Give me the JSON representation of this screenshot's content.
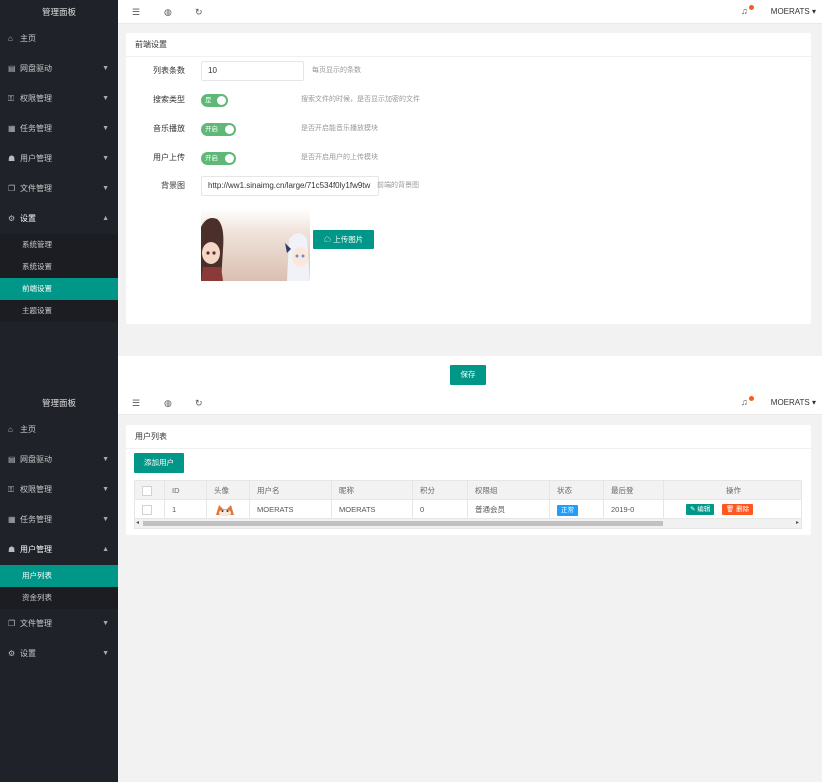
{
  "app_title": "管理面板",
  "user_name": "MOERATS",
  "icons": {
    "menu": "menu-icon",
    "globe": "globe-icon",
    "refresh": "refresh-icon",
    "bell": "bell-icon"
  },
  "accent_color": "#009688",
  "screen1": {
    "nav": [
      {
        "label": "主页",
        "icon": "home-icon",
        "glyph": "⌂",
        "arrow": ""
      },
      {
        "label": "网盘驱动",
        "icon": "drive-icon",
        "glyph": "▤",
        "arrow": "▼"
      },
      {
        "label": "权限管理",
        "icon": "key-icon",
        "glyph": "⚿",
        "arrow": "▼"
      },
      {
        "label": "任务管理",
        "icon": "list-icon",
        "glyph": "▦",
        "arrow": "▼"
      },
      {
        "label": "用户管理",
        "icon": "users-icon",
        "glyph": "☗",
        "arrow": "▼"
      },
      {
        "label": "文件管理",
        "icon": "files-icon",
        "glyph": "❐",
        "arrow": "▼"
      },
      {
        "label": "设置",
        "icon": "gear-icon",
        "glyph": "⚙",
        "arrow": "▲"
      }
    ],
    "submenu": [
      "系统管理",
      "系统设置",
      "前端设置",
      "主题设置"
    ],
    "card_title": "前端设置",
    "form": {
      "list_count": {
        "label": "列表条数",
        "value": "10",
        "tip": "每页显示的条数"
      },
      "search_type": {
        "label": "搜索类型",
        "switch_text": "是",
        "tip": "搜索文件的时候，是否显示加密的文件"
      },
      "music_play": {
        "label": "音乐播放",
        "switch_text": "开启",
        "tip": "是否开启能音乐播放模块"
      },
      "user_upload": {
        "label": "用户上传",
        "switch_text": "开启",
        "tip": "是否开启用户的上传模块"
      },
      "background": {
        "label": "背景图",
        "value": "http://ww1.sinaimg.cn/large/71c534f0ly1fw9tw",
        "tip": "前端的背景图"
      }
    },
    "upload_button": "上传图片",
    "save_button": "保存"
  },
  "screen2": {
    "nav": [
      {
        "label": "主页",
        "icon": "home-icon",
        "glyph": "⌂",
        "arrow": ""
      },
      {
        "label": "网盘驱动",
        "icon": "drive-icon",
        "glyph": "▤",
        "arrow": "▼"
      },
      {
        "label": "权限管理",
        "icon": "key-icon",
        "glyph": "⚿",
        "arrow": "▼"
      },
      {
        "label": "任务管理",
        "icon": "list-icon",
        "glyph": "▦",
        "arrow": "▼"
      },
      {
        "label": "用户管理",
        "icon": "users-icon",
        "glyph": "☗",
        "arrow": "▲"
      },
      {
        "label": "文件管理",
        "icon": "files-icon",
        "glyph": "❐",
        "arrow": "▼"
      },
      {
        "label": "设置",
        "icon": "gear-icon",
        "glyph": "⚙",
        "arrow": "▼"
      }
    ],
    "submenu": [
      "用户列表",
      "资金列表"
    ],
    "card_title": "用户列表",
    "add_button": "添加用户",
    "table": {
      "headers": [
        "ID",
        "头像",
        "用户名",
        "昵称",
        "积分",
        "权限组",
        "状态",
        "最后登",
        "操作"
      ],
      "row": {
        "id": "1",
        "username": "MOERATS",
        "nickname": "MOERATS",
        "points": "0",
        "group": "普通会员",
        "status": "正常",
        "last_login": "2019-0"
      },
      "edit": "编辑",
      "delete": "删除"
    }
  }
}
